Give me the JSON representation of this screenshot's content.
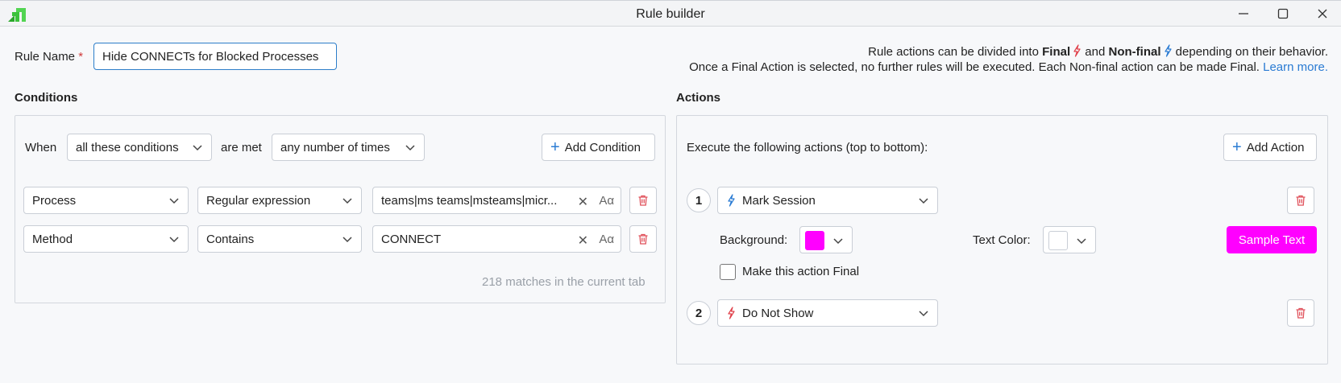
{
  "window": {
    "title": "Rule builder"
  },
  "rule_name": {
    "label": "Rule Name",
    "required_mark": "*",
    "value": "Hide CONNECTs for Blocked Processes"
  },
  "info": {
    "line1_prefix": "Rule actions can be divided into ",
    "final": "Final",
    "and": " and ",
    "non_final": "Non-final",
    "line1_suffix": " depending on their behavior.",
    "line2": "Once a Final Action is selected, no further rules will be executed. Each Non-final action can be made Final. ",
    "learn_more": "Learn more."
  },
  "conditions": {
    "title": "Conditions",
    "when": "When",
    "match_mode": "all these conditions",
    "are_met": "are met",
    "frequency": "any number of times",
    "add_label": "Add Condition",
    "rows": [
      {
        "field": "Process",
        "operator": "Regular expression",
        "value": "teams|ms teams|msteams|micr..."
      },
      {
        "field": "Method",
        "operator": "Contains",
        "value": "CONNECT"
      }
    ],
    "case_toggle": "Aα",
    "clear": "✕",
    "matches": "218 matches in the current tab"
  },
  "actions": {
    "title": "Actions",
    "execute_text": "Execute the following actions (top to bottom):",
    "add_label": "Add Action",
    "items": [
      {
        "number": "1",
        "name": "Mark Session",
        "kind": "non-final"
      },
      {
        "number": "2",
        "name": "Do Not Show",
        "kind": "final"
      }
    ],
    "background_label": "Background:",
    "text_color_label": "Text Color:",
    "background_color": "#ff00ff",
    "text_color": "#ffffff",
    "sample_text": "Sample Text",
    "make_final_label": "Make this action Final"
  },
  "colors": {
    "accent": "#2a7bd3",
    "final_bolt": "#e0404a",
    "nonfinal_bolt": "#2a7bd3",
    "delete_icon": "#e0505a",
    "logo": "#3cc23c"
  }
}
